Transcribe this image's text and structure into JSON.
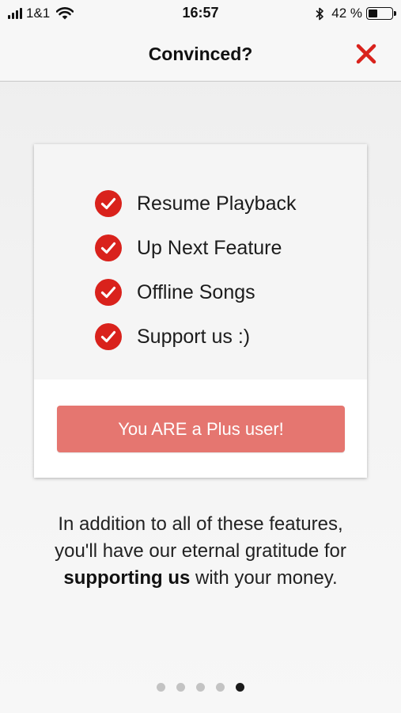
{
  "status_bar": {
    "carrier": "1&1",
    "time": "16:57",
    "battery_percent": "42 %",
    "battery_level": 0.42
  },
  "nav": {
    "title": "Convinced?",
    "close_icon": "close-x-icon"
  },
  "card": {
    "features": [
      {
        "label": "Resume Playback",
        "icon": "check-circle-icon"
      },
      {
        "label": "Up Next Feature",
        "icon": "check-circle-icon"
      },
      {
        "label": "Offline Songs",
        "icon": "check-circle-icon"
      },
      {
        "label": "Support us :)",
        "icon": "check-circle-icon"
      }
    ],
    "plus_button_label": "You ARE a Plus user!"
  },
  "blurb": {
    "line1": "In addition to all of these features,",
    "line2": "you'll have our eternal gratitude for",
    "line3_bold": "supporting us",
    "line3_rest": " with your money."
  },
  "pager": {
    "total": 5,
    "active_index": 4
  },
  "colors": {
    "accent_red": "#d9221c",
    "button_red": "#e57670"
  }
}
